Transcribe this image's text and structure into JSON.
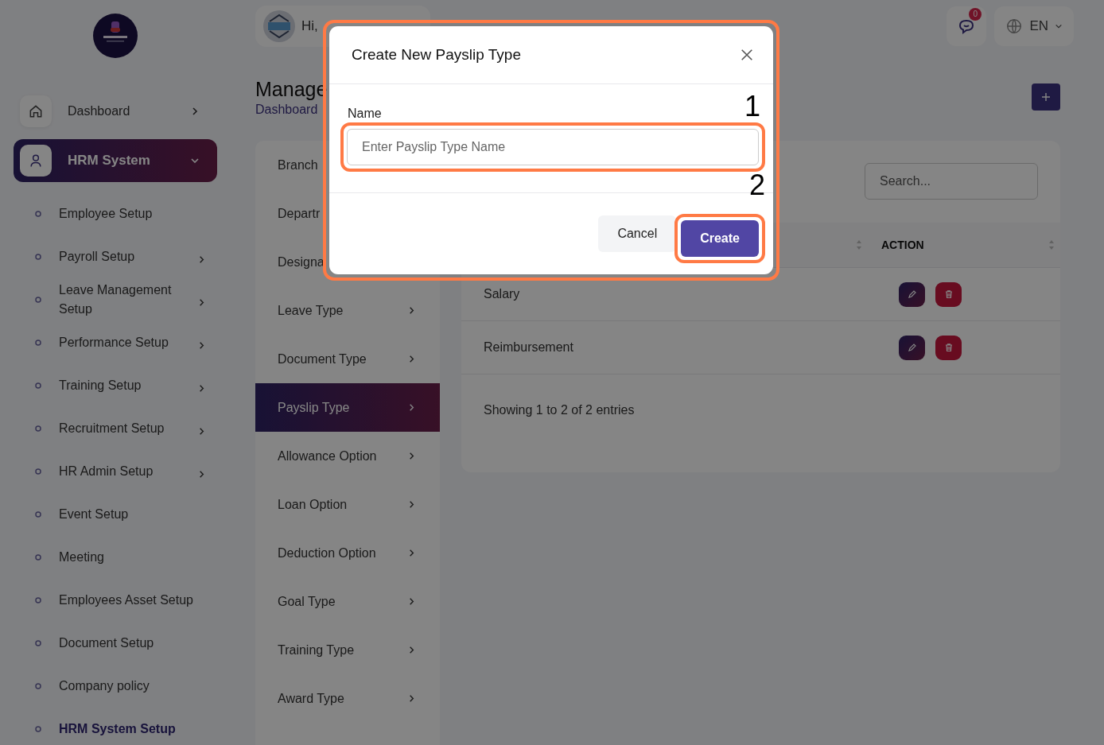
{
  "header": {
    "greeting": "Hi,",
    "notification_count": "0",
    "language": "EN"
  },
  "sidebar": {
    "main_items": [
      {
        "label": "Dashboard",
        "kind": "home",
        "selected": false,
        "expanded": false
      },
      {
        "label": "HRM System",
        "kind": "user",
        "selected": true,
        "expanded": true
      }
    ],
    "sub_items": [
      {
        "label": "Employee Setup",
        "has_submenu": false,
        "selected": false
      },
      {
        "label": "Payroll Setup",
        "has_submenu": true,
        "selected": false
      },
      {
        "label": "Leave Management Setup",
        "has_submenu": true,
        "selected": false
      },
      {
        "label": "Performance Setup",
        "has_submenu": true,
        "selected": false
      },
      {
        "label": "Training Setup",
        "has_submenu": true,
        "selected": false
      },
      {
        "label": "Recruitment Setup",
        "has_submenu": true,
        "selected": false
      },
      {
        "label": "HR Admin Setup",
        "has_submenu": true,
        "selected": false
      },
      {
        "label": "Event Setup",
        "has_submenu": false,
        "selected": false
      },
      {
        "label": "Meeting",
        "has_submenu": false,
        "selected": false
      },
      {
        "label": "Employees Asset Setup",
        "has_submenu": false,
        "selected": false
      },
      {
        "label": "Document Setup",
        "has_submenu": false,
        "selected": false
      },
      {
        "label": "Company policy",
        "has_submenu": false,
        "selected": false
      },
      {
        "label": "HRM System Setup",
        "has_submenu": false,
        "selected": true
      }
    ]
  },
  "page": {
    "title": "Manage",
    "breadcrumb": "Dashboard"
  },
  "setup_menu": [
    {
      "label": "Branch",
      "selected": false
    },
    {
      "label": "Departr",
      "selected": false
    },
    {
      "label": "Designa",
      "selected": false
    },
    {
      "label": "Leave Type",
      "selected": false
    },
    {
      "label": "Document Type",
      "selected": false
    },
    {
      "label": "Payslip Type",
      "selected": true
    },
    {
      "label": "Allowance Option",
      "selected": false
    },
    {
      "label": "Loan Option",
      "selected": false
    },
    {
      "label": "Deduction Option",
      "selected": false
    },
    {
      "label": "Goal Type",
      "selected": false
    },
    {
      "label": "Training Type",
      "selected": false
    },
    {
      "label": "Award Type",
      "selected": false
    }
  ],
  "table": {
    "search_placeholder": "Search...",
    "action_column": "ACTION",
    "rows": [
      {
        "name": "Salary"
      },
      {
        "name": "Reimbursement"
      }
    ],
    "footer": "Showing 1 to 2 of 2 entries"
  },
  "modal": {
    "title": "Create New Payslip Type",
    "field_label": "Name",
    "field_placeholder": "Enter Payslip Type Name",
    "buttons": {
      "cancel": "Cancel",
      "create": "Create"
    }
  },
  "annotations": [
    "1",
    "2"
  ]
}
